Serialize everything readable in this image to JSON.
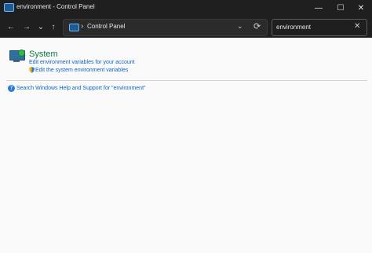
{
  "window": {
    "title": "environment - Control Panel",
    "controls": {
      "minimize": "—",
      "maximize": "☐",
      "close": "✕"
    }
  },
  "navigation": {
    "back_icon": "←",
    "forward_icon": "→",
    "recent_icon": "⌄",
    "up_icon": "↑"
  },
  "addressbar": {
    "chevron": "›",
    "location": "Control Panel",
    "dropdown": "⌄",
    "refresh": "⟳"
  },
  "search": {
    "value": "environment",
    "clear_icon": "✕"
  },
  "results": {
    "system": {
      "title": "System",
      "links": [
        "Edit environment variables for your account",
        "Edit the system environment variables"
      ]
    },
    "help": {
      "text": "Search Windows Help and Support for \"environment\""
    }
  },
  "colors": {
    "titlebar_bg": "#1f1f1f",
    "link": "#0b63c5",
    "system_title": "#0b7a3d"
  }
}
